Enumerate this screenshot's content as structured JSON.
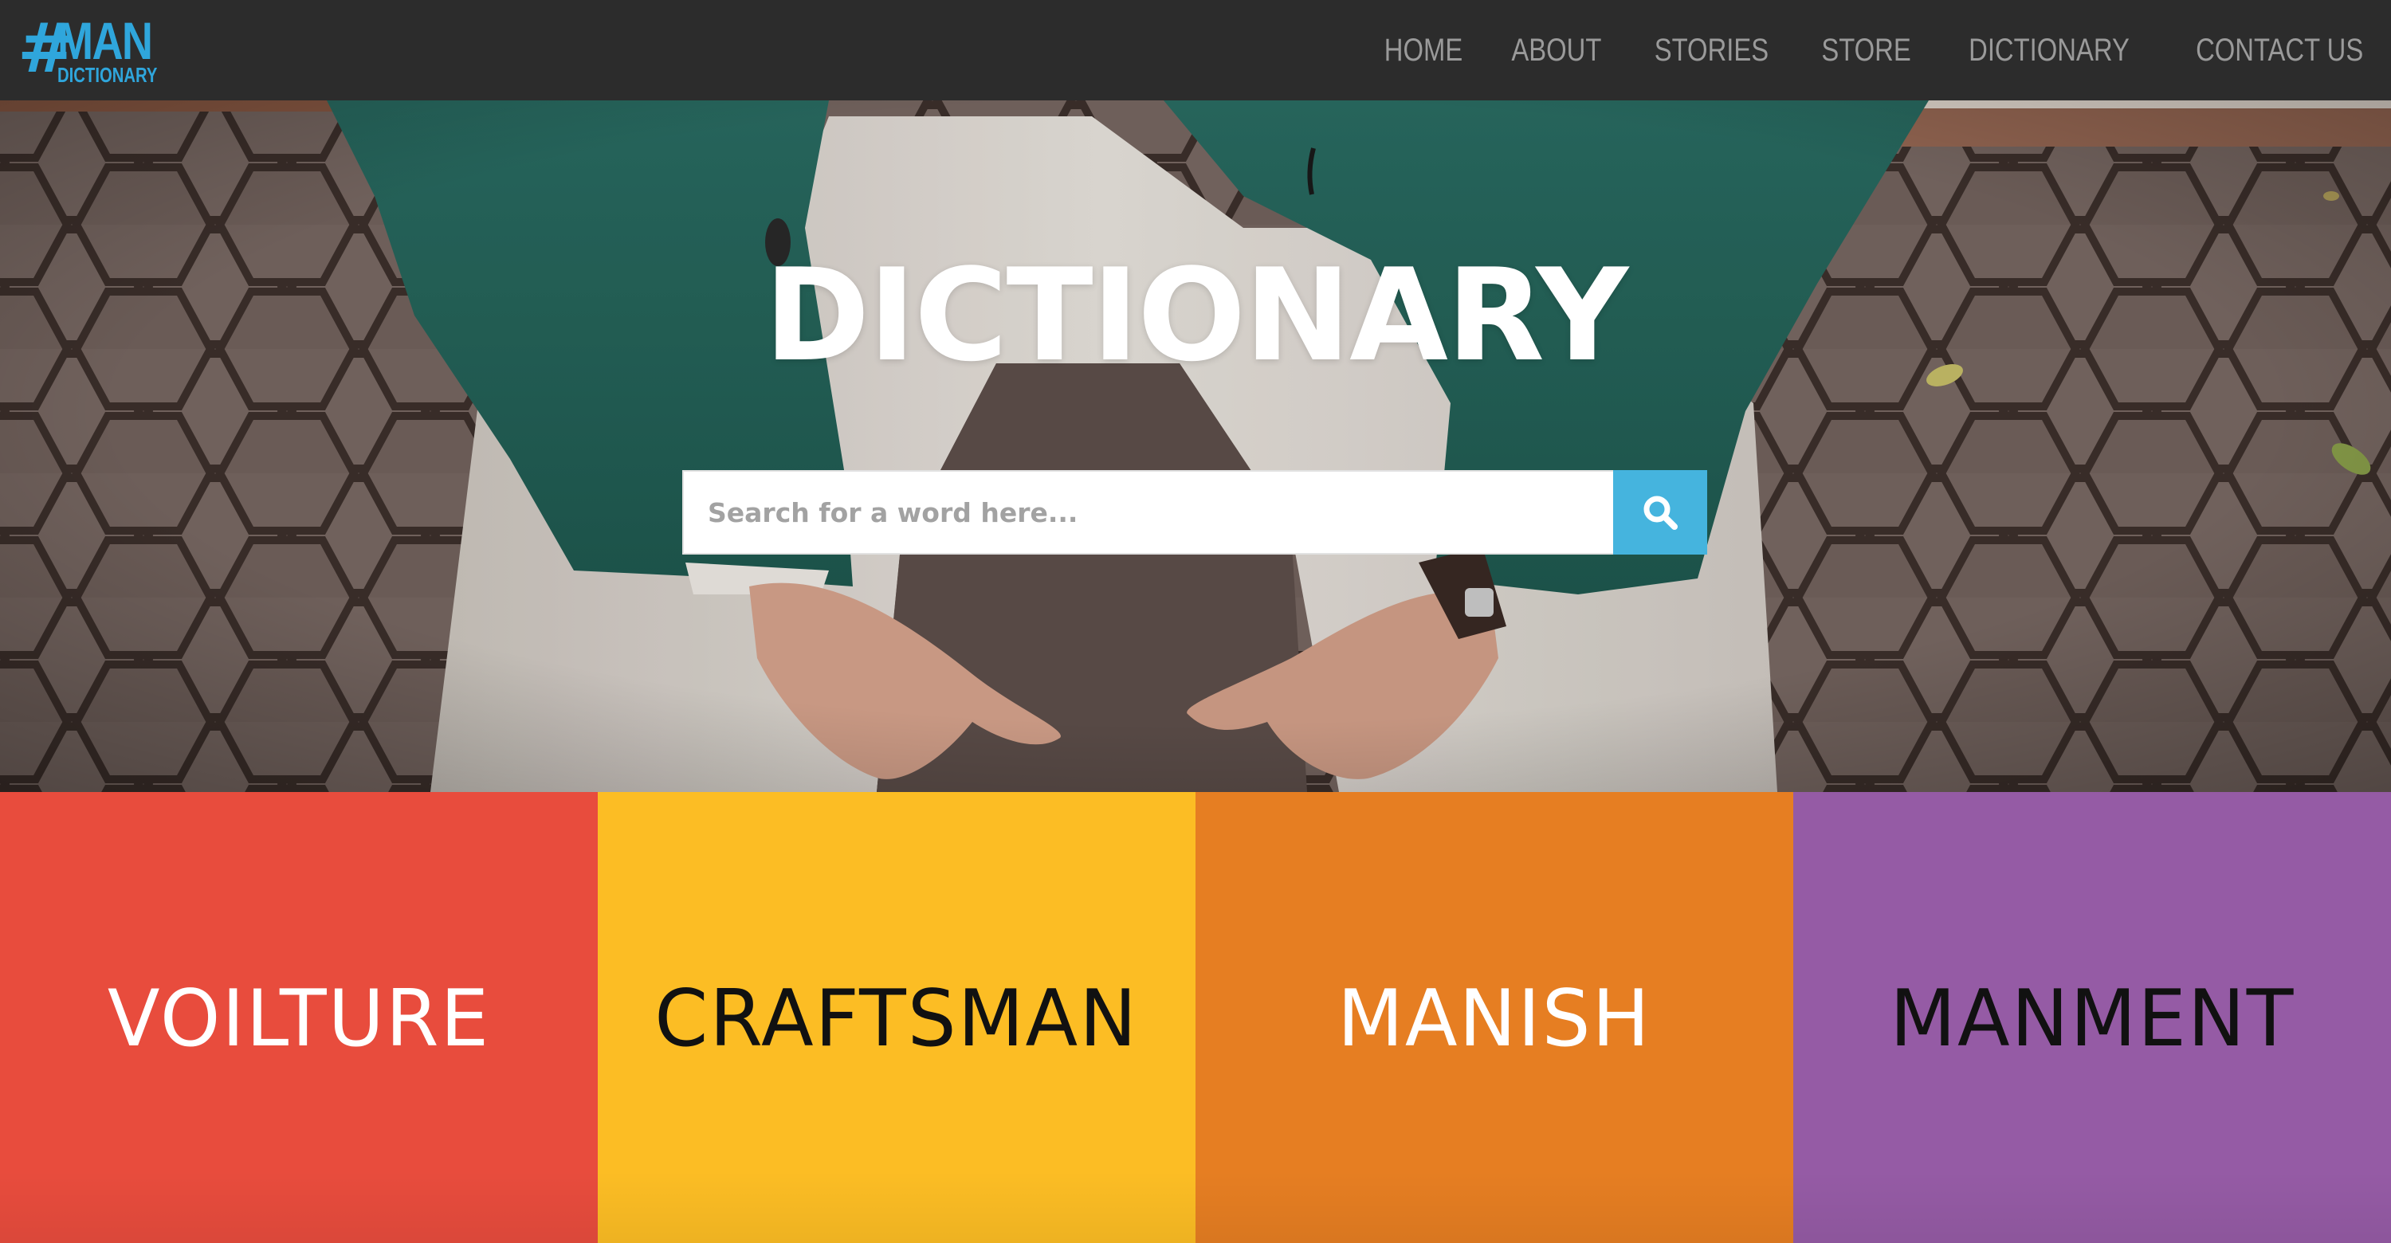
{
  "brand": {
    "hash": "#",
    "name": "MAN",
    "sub": "DICTIONARY",
    "color": "#2fa6dc"
  },
  "nav": {
    "items": [
      {
        "label": "HOME"
      },
      {
        "label": "ABOUT"
      },
      {
        "label": "STORIES"
      },
      {
        "label": "STORE"
      },
      {
        "label": "DICTIONARY"
      },
      {
        "label": "CONTACT US"
      }
    ]
  },
  "hero": {
    "title": "DICTIONARY",
    "search": {
      "placeholder": "Search for a word here...",
      "value": "",
      "button_icon": "search-icon",
      "button_color": "#45b4de"
    }
  },
  "tiles": [
    {
      "word": "VOILTURE",
      "bg": "#e84c3d",
      "fg": "#ffffff"
    },
    {
      "word": "CRAFTSMAN",
      "bg": "#fcbd24",
      "fg": "#111111"
    },
    {
      "word": "MANISH",
      "bg": "#e67e22",
      "fg": "#ffffff"
    },
    {
      "word": "MANMENT",
      "bg": "#955ba5",
      "fg": "#111111"
    }
  ]
}
